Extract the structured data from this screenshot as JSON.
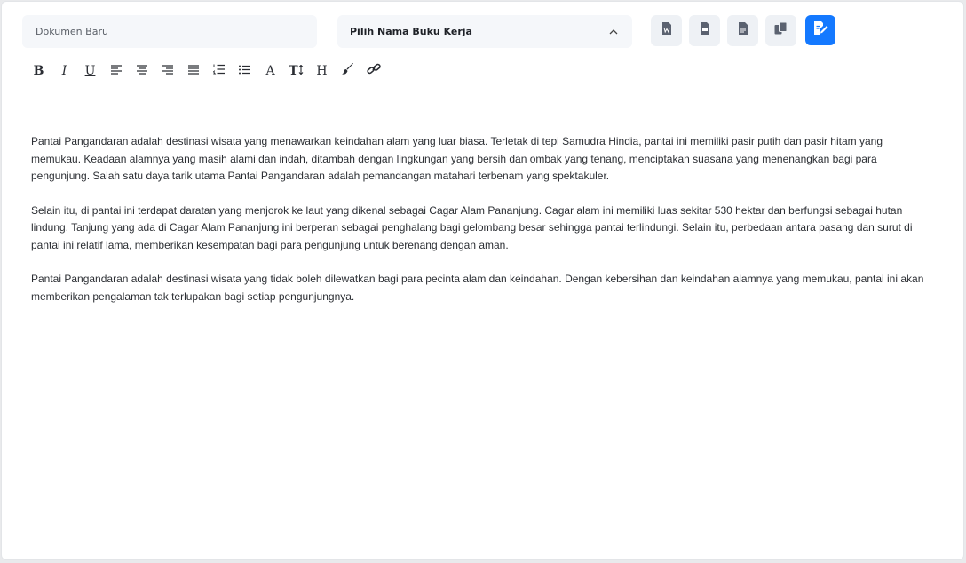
{
  "document": {
    "name_placeholder": "Dokumen Baru"
  },
  "workbook_select": {
    "label": "Pilih Nama Buku Kerja"
  },
  "actions": [
    {
      "name": "export-word-button",
      "icon": "word-file-icon"
    },
    {
      "name": "export-pdf-button",
      "icon": "pdf-file-icon"
    },
    {
      "name": "export-text-button",
      "icon": "text-file-icon"
    },
    {
      "name": "copy-button",
      "icon": "copy-icon"
    },
    {
      "name": "save-button",
      "icon": "save-file-icon",
      "color": "#1479ff"
    }
  ],
  "toolbar": {
    "bold": "B",
    "italic": "I",
    "underline": "U",
    "font_color": "A",
    "font_size": "T",
    "heading": "H"
  },
  "content": {
    "paragraphs": [
      "Pantai Pangandaran adalah destinasi wisata yang menawarkan keindahan alam yang luar biasa. Terletak di tepi Samudra Hindia, pantai ini memiliki pasir putih dan pasir hitam yang memukau. Keadaan alamnya yang masih alami dan indah, ditambah dengan lingkungan yang bersih dan ombak yang tenang, menciptakan suasana yang menenangkan bagi para pengunjung. Salah satu daya tarik utama Pantai Pangandaran adalah pemandangan matahari terbenam yang spektakuler.",
      "Selain itu, di pantai ini terdapat daratan yang menjorok ke laut yang dikenal sebagai Cagar Alam Pananjung. Cagar alam ini memiliki luas sekitar 530 hektar dan berfungsi sebagai hutan lindung. Tanjung yang ada di Cagar Alam Pananjung ini berperan sebagai penghalang bagi gelombang besar sehingga pantai terlindungi. Selain itu, perbedaan antara pasang dan surut di pantai ini relatif lama, memberikan kesempatan bagi para pengunjung untuk berenang dengan aman.",
      "Pantai Pangandaran adalah destinasi wisata yang tidak boleh dilewatkan bagi para pecinta alam dan keindahan. Dengan kebersihan dan keindahan alamnya yang memukau, pantai ini akan memberikan pengalaman tak terlupakan bagi setiap pengunjungnya."
    ]
  }
}
